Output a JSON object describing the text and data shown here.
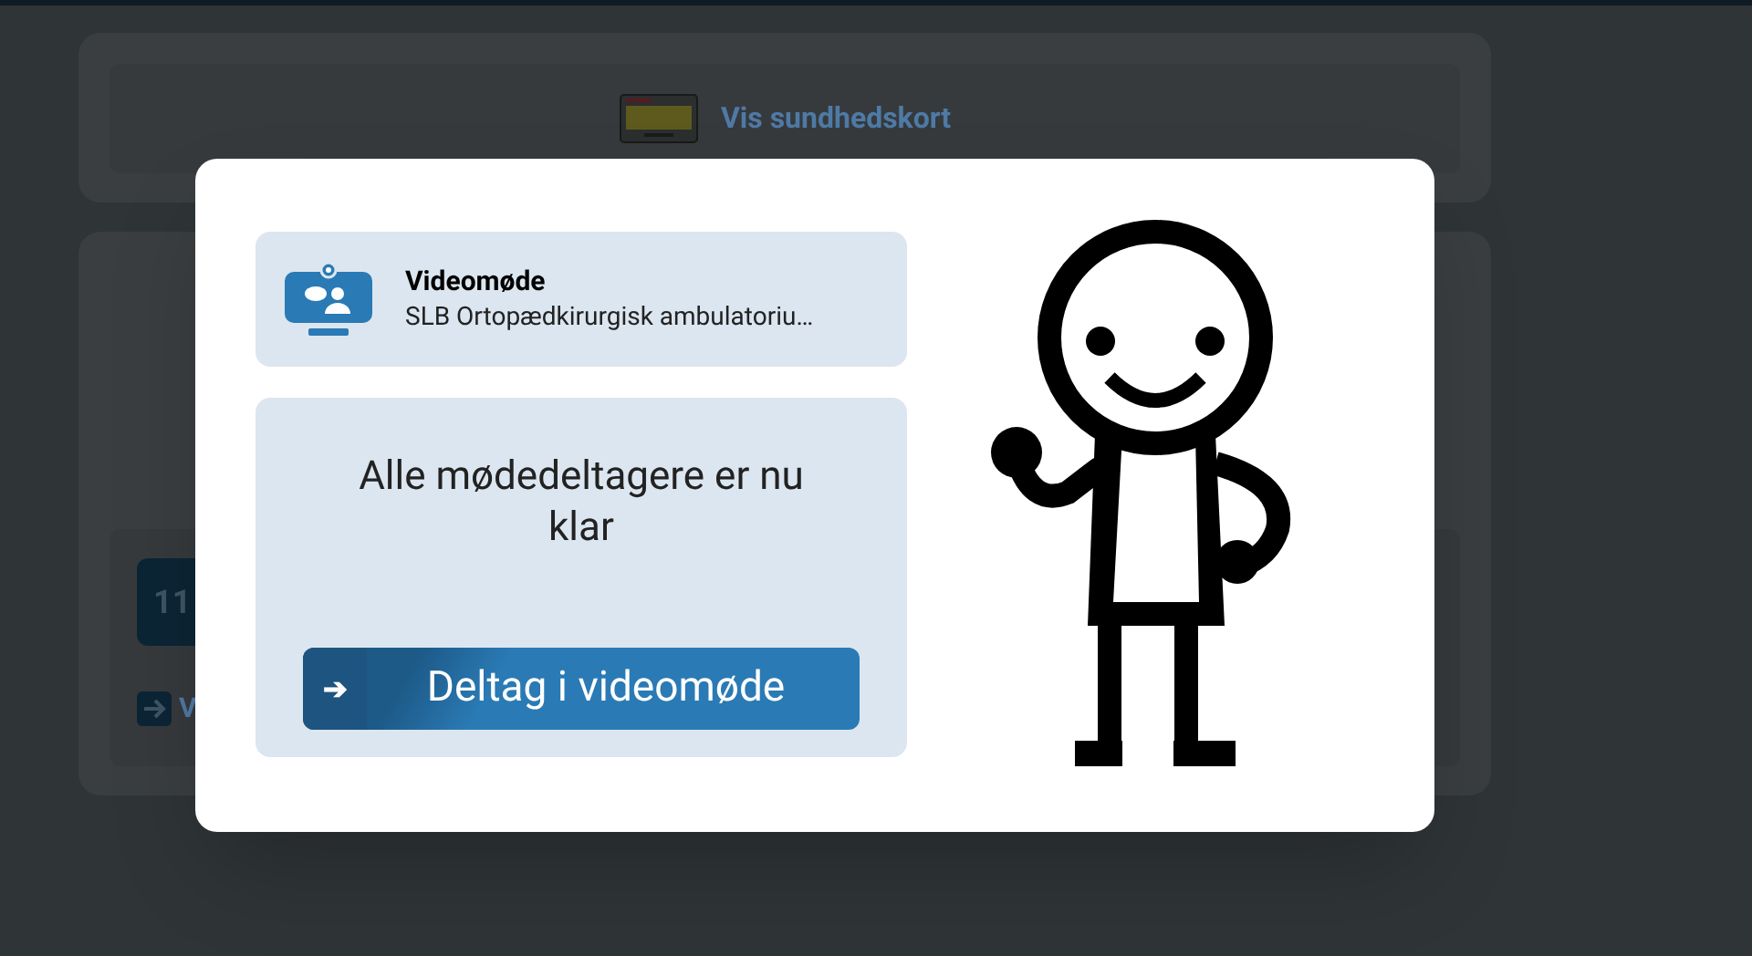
{
  "background": {
    "health_card_link": "Vis sundhedskort",
    "tile_text": "11",
    "link_text": "V"
  },
  "dialog": {
    "meeting": {
      "title": "Videomøde",
      "subtitle": "SLB Ortopædkirurgisk ambulatoriu…"
    },
    "message": "Alle mødedeltagere er nu klar",
    "join_button": {
      "arrow": "➔",
      "label": "Deltag i videomøde"
    }
  }
}
